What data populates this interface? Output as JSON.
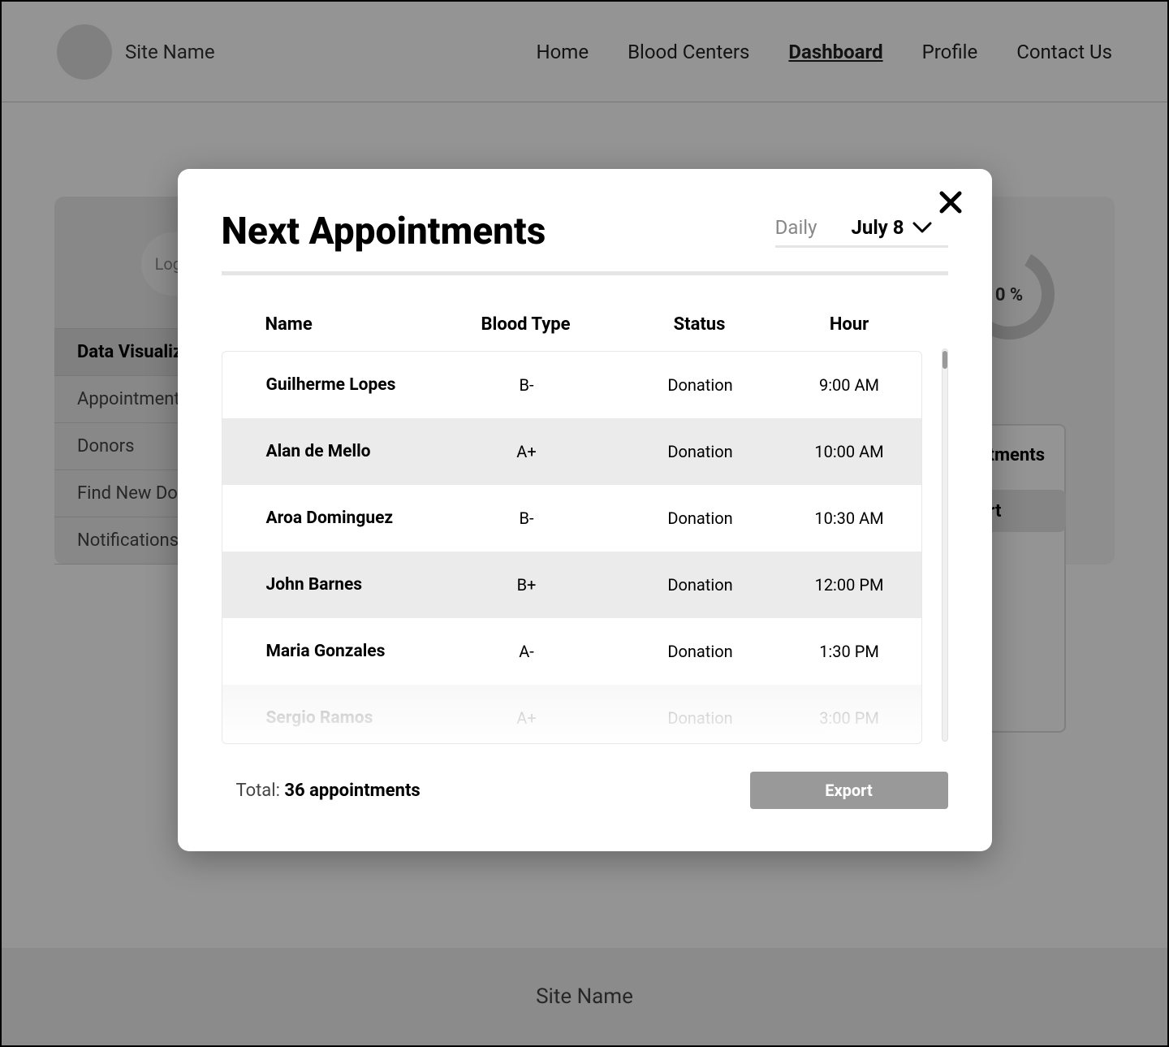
{
  "header": {
    "site_name": "Site Name",
    "nav": {
      "home": "Home",
      "blood_centers": "Blood Centers",
      "dashboard": "Dashboard",
      "profile": "Profile",
      "contact": "Contact Us"
    }
  },
  "sidebar": {
    "logo_text": "Logo",
    "items": {
      "data_viz": "Data Visualization",
      "appointments": "Appointments",
      "donors": "Donors",
      "find_donors": "Find New Donors",
      "notifications": "Notifications"
    }
  },
  "background": {
    "donut_percent": "0 %",
    "card_title": "ointments",
    "export_label": "port"
  },
  "modal": {
    "title": "Next Appointments",
    "daily_label": "Daily",
    "date_label": "July 8",
    "columns": {
      "name": "Name",
      "blood_type": "Blood Type",
      "status": "Status",
      "hour": "Hour"
    },
    "rows": [
      {
        "name": "Guilherme Lopes",
        "blood": "B-",
        "status": "Donation",
        "hour": "9:00 AM"
      },
      {
        "name": "Alan de Mello",
        "blood": "A+",
        "status": "Donation",
        "hour": "10:00 AM"
      },
      {
        "name": "Aroa Dominguez",
        "blood": "B-",
        "status": "Donation",
        "hour": "10:30 AM"
      },
      {
        "name": "John Barnes",
        "blood": "B+",
        "status": "Donation",
        "hour": "12:00 PM"
      },
      {
        "name": "Maria Gonzales",
        "blood": "A-",
        "status": "Donation",
        "hour": "1:30 PM"
      },
      {
        "name": "Sergio Ramos",
        "blood": "A+",
        "status": "Donation",
        "hour": "3:00 PM"
      }
    ],
    "total_label": "Total: ",
    "total_value": "36 appointments",
    "export_label": "Export"
  },
  "footer": {
    "site_name": "Site Name"
  }
}
